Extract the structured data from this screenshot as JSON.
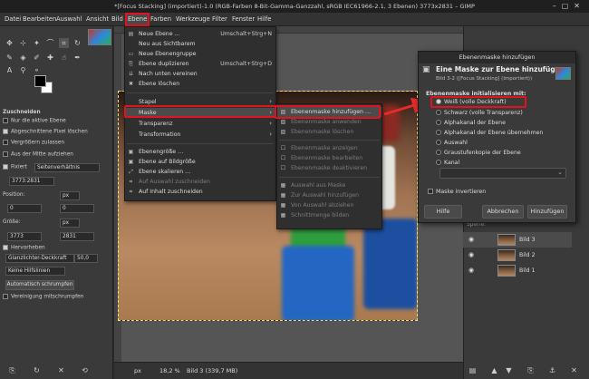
{
  "window": {
    "title": "*[Focus Stacking] (importiert)-1.0 (RGB-Farben 8-Bit-Gamma-Ganzzahl, sRGB IEC61966-2.1, 3 Ebenen) 3773x2831 – GIMP"
  },
  "menubar": [
    "Datei",
    "Bearbeiten",
    "Auswahl",
    "Ansicht",
    "Bild",
    "Ebene",
    "Farben",
    "Werkzeuge",
    "Filter",
    "Fenster",
    "Hilfe"
  ],
  "ebene_menu": {
    "items": [
      {
        "label": "Neue Ebene …",
        "shortcut": "Umschalt+Strg+N"
      },
      {
        "label": "Neu aus Sichtbarem",
        "shortcut": ""
      },
      {
        "label": "Neue Ebenengruppe",
        "shortcut": ""
      },
      {
        "label": "Ebene duplizieren",
        "shortcut": "Umschalt+Strg+D"
      },
      {
        "label": "Nach unten vereinen",
        "shortcut": ""
      },
      {
        "label": "Ebene löschen",
        "shortcut": ""
      },
      {
        "label": "Stapel",
        "shortcut": ""
      },
      {
        "label": "Maske",
        "shortcut": ""
      },
      {
        "label": "Transparenz",
        "shortcut": ""
      },
      {
        "label": "Transformation",
        "shortcut": ""
      },
      {
        "label": "Ebenengröße …",
        "shortcut": ""
      },
      {
        "label": "Ebene auf Bildgröße",
        "shortcut": ""
      },
      {
        "label": "Ebene skalieren …",
        "shortcut": ""
      },
      {
        "label": "Auf Auswahl zuschneiden",
        "shortcut": ""
      },
      {
        "label": "Auf Inhalt zuschneiden",
        "shortcut": ""
      }
    ]
  },
  "maske_submenu": {
    "items": [
      "Ebenenmaske hinzufügen …",
      "Ebenenmaske anwenden",
      "Ebenenmaske löschen",
      "Ebenenmaske anzeigen",
      "Ebenenmaske bearbeiten",
      "Ebenenmaske deaktivieren",
      "Auswahl aus Maske",
      "Zur Auswahl hinzufügen",
      "Von Auswahl abziehen",
      "Schnittmenge bilden"
    ]
  },
  "tool_options": {
    "section": "Zuschneiden",
    "current_layer_only": "Nur die aktive Ebene",
    "delete_cropped": "Abgeschnittene Pixel löschen",
    "allow_growing": "Vergrößern zulassen",
    "expand_center": "Aus der Mitte aufziehen",
    "fixed_label": "Fixiert",
    "fixed_value": "Seitenverhältnis",
    "ratio": "3773:2831",
    "position_label": "Position:",
    "position_unit": "px",
    "pos_x": "0",
    "pos_y": "0",
    "size_label": "Größe:",
    "size_unit": "px",
    "size_w": "3773",
    "size_h": "2831",
    "highlight": "Hervorheben",
    "highlight_value": "Glanzlichter-Deckkraft",
    "highlight_opacity": "50,0",
    "guides": "Keine Hilfslinien",
    "auto_shrink": "Automatisch schrumpfen",
    "shrink_merged": "Vereinigung mitschrumpfen"
  },
  "dialog": {
    "title": "Ebenenmaske hinzufügen",
    "heading": "Eine Maske zur Ebene hinzufügen",
    "subheading": "Bild 3-2 ([Focus Stacking] (importiert))",
    "init_label": "Ebenenmaske initialisieren mit:",
    "options": [
      "Weiß (volle Deckkraft)",
      "Schwarz (volle Transparenz)",
      "Alphakanal der Ebene",
      "Alphakanal der Ebene übernehmen",
      "Auswahl",
      "Graustufenkopie der Ebene",
      "Kanal"
    ],
    "invert": "Maske invertieren",
    "help": "Hilfe",
    "cancel": "Abbrechen",
    "add": "Hinzufügen"
  },
  "layers": {
    "mode_label": "Sperre:",
    "items": [
      "Bild 3",
      "Bild 2",
      "Bild 1"
    ]
  },
  "statusbar": {
    "unit": "px",
    "zoom": "18,2 %",
    "info": "Bild 3 (339,7 MB)"
  },
  "colors": {
    "highlight": "#e0141e",
    "arrow": "#e82a2a"
  }
}
